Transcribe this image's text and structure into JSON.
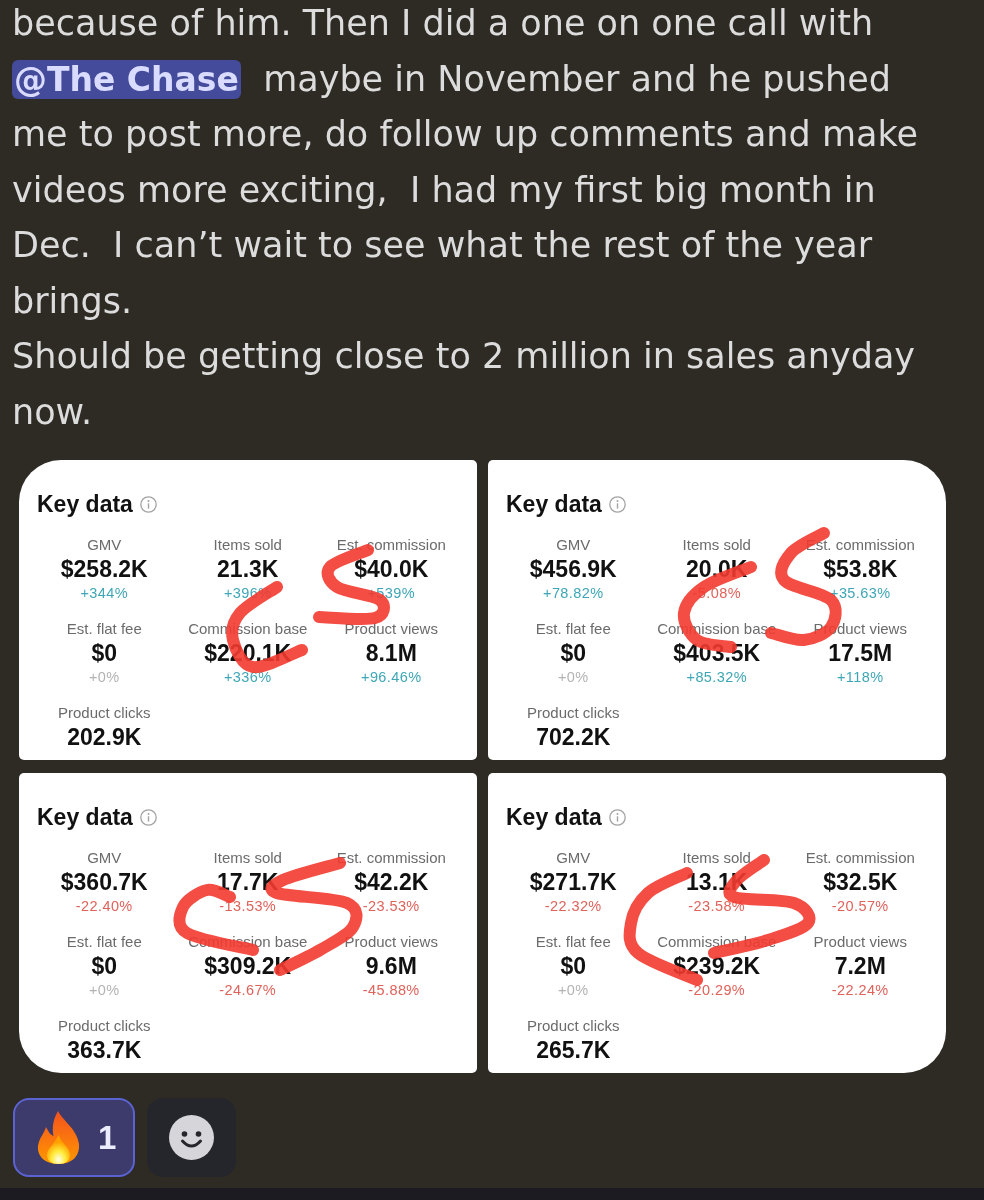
{
  "message": {
    "paragraphs": [
      {
        "lines": [
          [
            {
              "kind": "text",
              "text": "because of him. Then I did a one on one call with"
            }
          ],
          [
            {
              "kind": "mention",
              "text": "@The Chase"
            },
            {
              "kind": "text",
              "text": "  maybe in November and he pushed"
            }
          ],
          [
            {
              "kind": "text",
              "text": "me to post more, do follow up comments and make"
            }
          ],
          [
            {
              "kind": "text",
              "text": "videos more exciting,  I had my first big month in"
            }
          ],
          [
            {
              "kind": "text",
              "text": "Dec.  I can’t wait to see what the rest of the year"
            }
          ],
          [
            {
              "kind": "text",
              "text": "brings."
            }
          ]
        ]
      },
      {
        "lines": [
          [
            {
              "kind": "text",
              "text": "Should be getting close to 2 million in sales anyday"
            }
          ],
          [
            {
              "kind": "text",
              "text": "now."
            }
          ]
        ]
      }
    ]
  },
  "cards": [
    {
      "title": "Key data",
      "metrics": [
        {
          "label": "GMV",
          "value": "$258.2K",
          "change": "+344%",
          "color": "#3ea6b6"
        },
        {
          "label": "Items sold",
          "value": "21.3K",
          "change": "+396%",
          "color": "#3ea6b6"
        },
        {
          "label": "Est. commission",
          "value": "$40.0K",
          "change": "+539%",
          "color": "#3ea6b6"
        },
        {
          "label": "Est. flat fee",
          "value": "$0",
          "change": "+0%",
          "color": "#b3b3b3"
        },
        {
          "label": "Commission base",
          "value": "$220.1K",
          "change": "+336%",
          "color": "#3ea6b6"
        },
        {
          "label": "Product views",
          "value": "8.1M",
          "change": "+96.46%",
          "color": "#3ea6b6"
        },
        {
          "label": "Product clicks",
          "value": "202.9K"
        }
      ]
    },
    {
      "title": "Key data",
      "metrics": [
        {
          "label": "GMV",
          "value": "$456.9K",
          "change": "+78.82%",
          "color": "#3ea6b6"
        },
        {
          "label": "Items sold",
          "value": "20.0K",
          "change": "-5.08%",
          "color": "#df625b"
        },
        {
          "label": "Est. commission",
          "value": "$53.8K",
          "change": "+35.63%",
          "color": "#3ea6b6"
        },
        {
          "label": "Est. flat fee",
          "value": "$0",
          "change": "+0%",
          "color": "#b3b3b3"
        },
        {
          "label": "Commission base",
          "value": "$403.5K",
          "change": "+85.32%",
          "color": "#3ea6b6"
        },
        {
          "label": "Product views",
          "value": "17.5M",
          "change": "+118%",
          "color": "#3ea6b6"
        },
        {
          "label": "Product clicks",
          "value": "702.2K"
        }
      ]
    },
    {
      "title": "Key data",
      "metrics": [
        {
          "label": "GMV",
          "value": "$360.7K",
          "change": "-22.40%",
          "color": "#df625b"
        },
        {
          "label": "Items sold",
          "value": "17.7K",
          "change": "-13.53%",
          "color": "#df625b"
        },
        {
          "label": "Est. commission",
          "value": "$42.2K",
          "change": "-23.53%",
          "color": "#df625b"
        },
        {
          "label": "Est. flat fee",
          "value": "$0",
          "change": "+0%",
          "color": "#b3b3b3"
        },
        {
          "label": "Commission base",
          "value": "$309.2K",
          "change": "-24.67%",
          "color": "#df625b"
        },
        {
          "label": "Product views",
          "value": "9.6M",
          "change": "-45.88%",
          "color": "#df625b"
        },
        {
          "label": "Product clicks",
          "value": "363.7K"
        }
      ]
    },
    {
      "title": "Key data",
      "metrics": [
        {
          "label": "GMV",
          "value": "$271.7K",
          "change": "-22.32%",
          "color": "#df625b"
        },
        {
          "label": "Items sold",
          "value": "13.1K",
          "change": "-23.58%",
          "color": "#df625b"
        },
        {
          "label": "Est. commission",
          "value": "$32.5K",
          "change": "-20.57%",
          "color": "#df625b"
        },
        {
          "label": "Est. flat fee",
          "value": "$0",
          "change": "+0%",
          "color": "#b3b3b3"
        },
        {
          "label": "Commission base",
          "value": "$239.2K",
          "change": "-20.29%",
          "color": "#df625b"
        },
        {
          "label": "Product views",
          "value": "7.2M",
          "change": "-22.24%",
          "color": "#df625b"
        },
        {
          "label": "Product clicks",
          "value": "265.7K"
        }
      ]
    }
  ],
  "reactions": [
    {
      "count": "1",
      "selected": true
    }
  ]
}
